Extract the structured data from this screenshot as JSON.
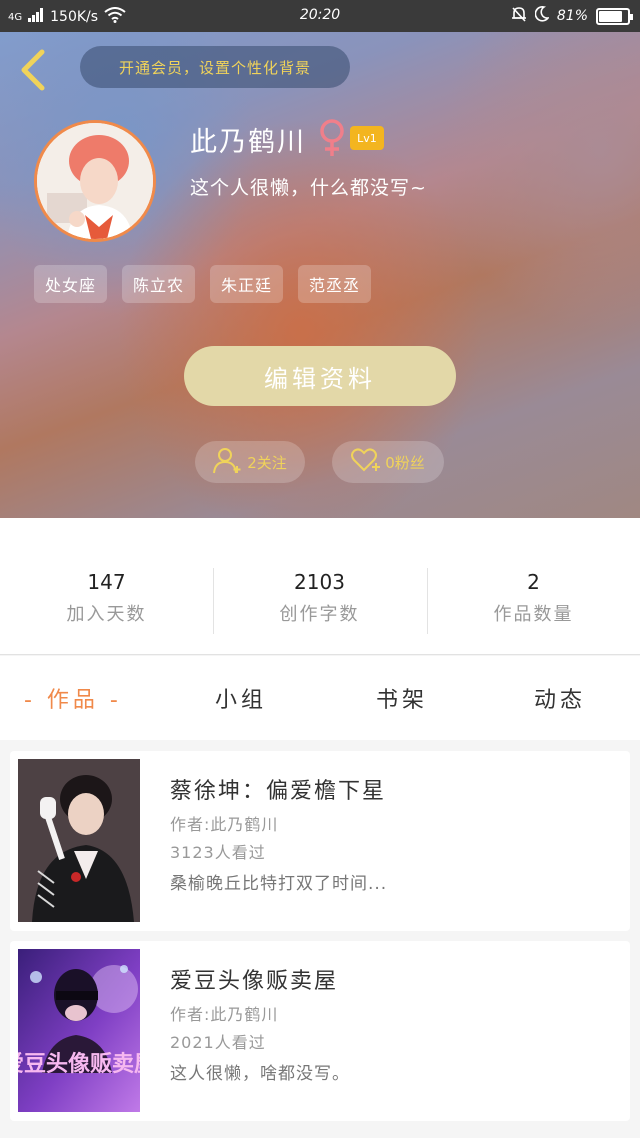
{
  "status_bar": {
    "network": "4G",
    "speed": "150K/s",
    "time": "20:20",
    "battery": "81%",
    "battery_level": 0.81
  },
  "header": {
    "member_promo": "开通会员，设置个性化背景",
    "username": "此乃鹤川",
    "gender_symbol": "♀",
    "level": "Lv1",
    "bio": "这个人很懒，什么都没写~",
    "tags": [
      "处女座",
      "陈立农",
      "朱正廷",
      "范丞丞"
    ],
    "edit_label": "编辑资料",
    "follow_label": "2关注",
    "fans_label": "0粉丝"
  },
  "stats": [
    {
      "value": "147",
      "label": "加入天数"
    },
    {
      "value": "2103",
      "label": "创作字数"
    },
    {
      "value": "2",
      "label": "作品数量"
    }
  ],
  "tabs": [
    "- 作品 -",
    "小组",
    "书架",
    "动态"
  ],
  "books": [
    {
      "title": "蔡徐坤：偏爱檐下星",
      "author": "作者:此乃鹤川",
      "views": "3123人看过",
      "desc": "桑榆晚丘比特打双了时间..."
    },
    {
      "title": "爱豆头像贩卖屋",
      "author": "作者:此乃鹤川",
      "views": "2021人看过",
      "desc": "这人很懒，啥都没写。",
      "cover_text": "爱豆头像贩卖屋"
    }
  ],
  "colors": {
    "accent": "#f0894a",
    "gold": "#f0d35a",
    "edit_button": "#e3d8a8",
    "gender": "#f07f8a",
    "level_badge": "#f3b51f"
  }
}
